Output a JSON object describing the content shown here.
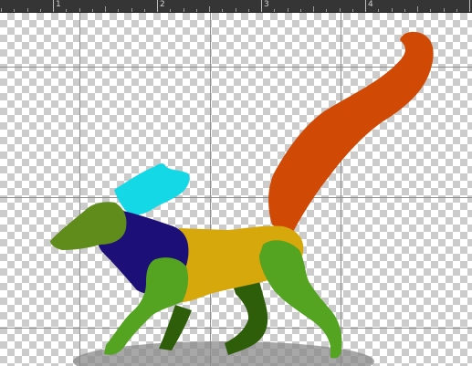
{
  "ruler": {
    "labels": [
      "1",
      "2",
      "3",
      "4"
    ]
  },
  "artwork": {
    "colors": {
      "tail": "#d04a06",
      "ear": "#15d8e6",
      "head": "#5f8c1a",
      "chest": "#1c0f78",
      "body": "#d7a80c",
      "front_leg_near": "#54a321",
      "front_leg_far": "#2f5e0b",
      "hind_leg_near": "#54a321",
      "hind_leg_far": "#2f5e0b",
      "shadow": "#8a8a8a",
      "guides": "#8e8e8e"
    }
  }
}
